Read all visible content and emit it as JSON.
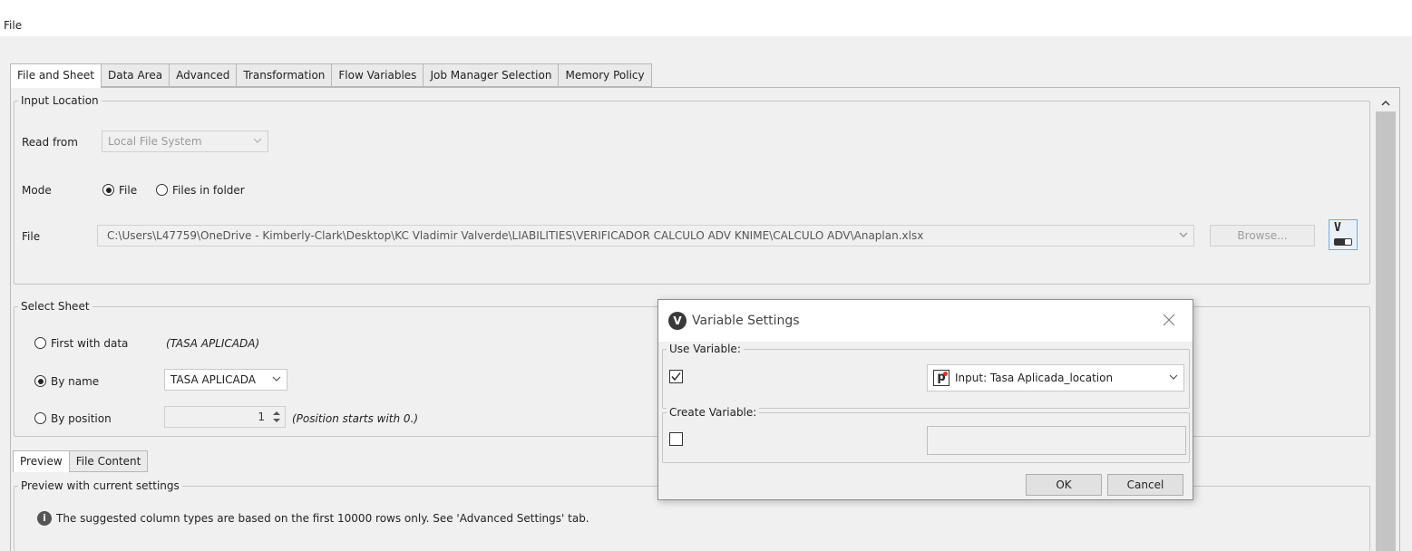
{
  "menu": {
    "file": "File"
  },
  "tabs": [
    {
      "label": "File and Sheet",
      "active": true
    },
    {
      "label": "Data Area"
    },
    {
      "label": "Advanced"
    },
    {
      "label": "Transformation"
    },
    {
      "label": "Flow Variables"
    },
    {
      "label": "Job Manager Selection"
    },
    {
      "label": "Memory Policy"
    }
  ],
  "input_location": {
    "legend": "Input Location",
    "read_from_label": "Read from",
    "read_from_value": "Local File System",
    "mode_label": "Mode",
    "mode_file": "File",
    "mode_folder": "Files in folder",
    "file_label": "File",
    "file_path": "C:\\Users\\L47759\\OneDrive - Kimberly-Clark\\Desktop\\KC Vladimir Valverde\\LIABILITIES\\VERIFICADOR CALCULO ADV KNIME\\CALCULO ADV\\Anaplan.xlsx",
    "browse_label": "Browse...",
    "variable_icon_letter": "V"
  },
  "select_sheet": {
    "legend": "Select Sheet",
    "first_with_data": "First with data",
    "first_with_data_value": "(TASA APLICADA)",
    "by_name": "By name",
    "by_name_value": "TASA APLICADA",
    "by_position": "By position",
    "position_value": "1",
    "position_hint": "(Position starts with 0.)"
  },
  "preview_tabs": [
    {
      "label": "Preview",
      "active": true
    },
    {
      "label": "File Content"
    }
  ],
  "preview": {
    "legend": "Preview with current settings",
    "info_text": "The suggested column types are based on the first 10000 rows only. See 'Advanced Settings' tab."
  },
  "dialog": {
    "title": "Variable Settings",
    "logo_letter": "V",
    "use_variable_legend": "Use Variable:",
    "use_variable_checked": true,
    "variable_type_letter": "p",
    "variable_value": "Input: Tasa Aplicada_location",
    "create_variable_legend": "Create Variable:",
    "create_variable_checked": false,
    "create_variable_value": "",
    "ok_label": "OK",
    "cancel_label": "Cancel"
  },
  "colors": {
    "background": "#f0f0f0",
    "knime_variable_orange": "#f29b1d",
    "info_icon": "#555555",
    "dialog_logo": "#3a3a3a"
  }
}
